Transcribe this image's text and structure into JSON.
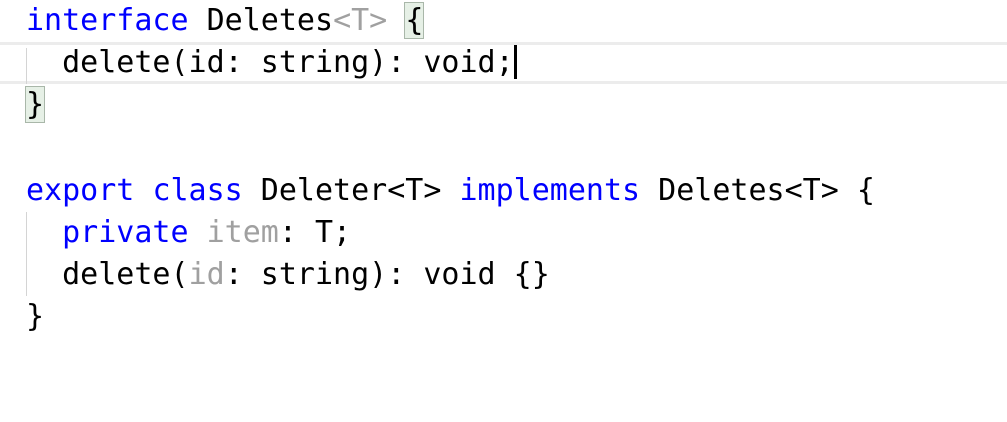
{
  "editor": {
    "lines": [
      {
        "parts": [
          "interface",
          " Deletes",
          "<T>",
          " ",
          "{"
        ]
      },
      {
        "parts": [
          "  delete(id: string): void;"
        ]
      },
      {
        "parts": [
          "}"
        ]
      },
      {
        "parts": []
      },
      {
        "parts": [
          "export",
          " ",
          "class",
          " Deleter<T> ",
          "implements",
          " Deletes<T> {"
        ]
      },
      {
        "parts": [
          "  ",
          "private",
          " ",
          "item",
          ": T;"
        ]
      },
      {
        "parts": [
          "  delete(",
          "id",
          ": string): void {}"
        ]
      },
      {
        "parts": [
          "}"
        ]
      }
    ]
  },
  "colors": {
    "keyword": "#0000ff",
    "unused": "#a0a0a0",
    "bracket_match_bg": "#e6f0e6"
  }
}
